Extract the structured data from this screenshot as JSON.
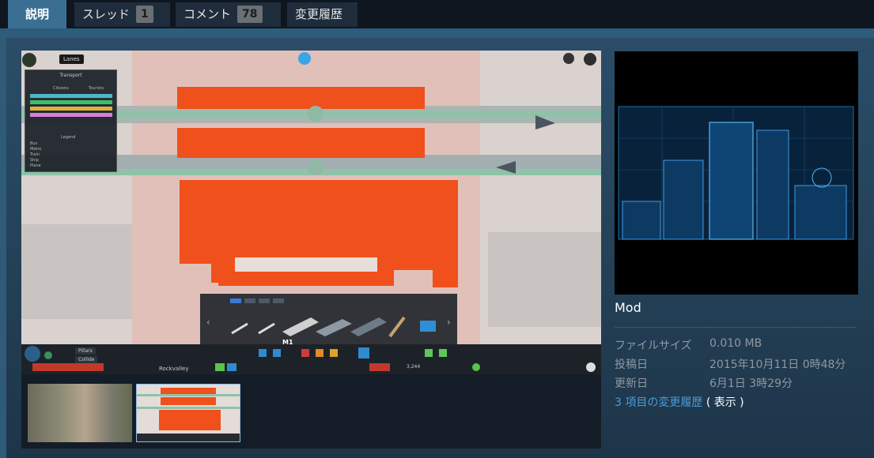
{
  "tabs": [
    {
      "label": "説明",
      "badge": null
    },
    {
      "label": "スレッド",
      "badge": "1"
    },
    {
      "label": "コメント",
      "badge": "78"
    },
    {
      "label": "変更履歴",
      "badge": null
    }
  ],
  "screenshot": {
    "lanes_label": "Lanes",
    "panel_title": "Transport",
    "col_citizens": "Citizens",
    "col_tourists": "Tourists",
    "legend_title": "Legend",
    "legend_items": [
      "Bus",
      "Metro",
      "Train",
      "Ship",
      "Plane"
    ],
    "tool_label": "M1",
    "city_name": "Rockvalley",
    "pill_pillars": "Pillars",
    "pill_collide": "Collide",
    "population": "3,244",
    "row_colors": [
      "#4fb6c9",
      "#3cc06a",
      "#e0b23a",
      "#d97bd8"
    ]
  },
  "sidebar": {
    "title": "Mod",
    "file_size_label": "ファイルサイズ",
    "file_size_value": "0.010 MB",
    "posted_label": "投稿日",
    "posted_value": "2015年10月11日 0時48分",
    "updated_label": "更新日",
    "updated_value": "6月1日 3時29分",
    "history_link": "3 項目の変更履歴",
    "history_show": "( 表示 )"
  },
  "colors": {
    "accent": "#3a6f92",
    "link": "#4a9cd6",
    "highlight_orange": "#f0501c"
  }
}
